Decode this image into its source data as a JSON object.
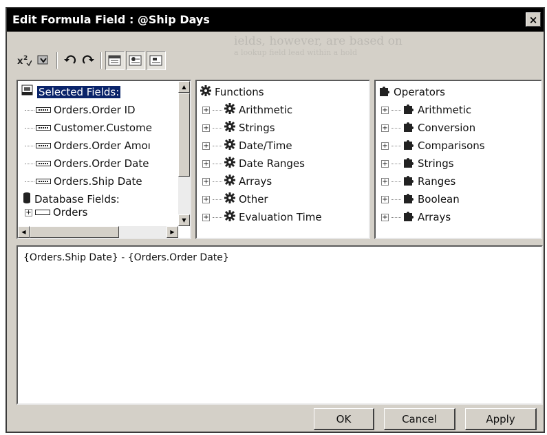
{
  "window": {
    "title": "Edit Formula Field : @Ship Days",
    "close_label": "×"
  },
  "background_text": {
    "line1": "ields, however, are based on  ",
    "line2": "a lookup field  lead within a hold"
  },
  "toolbar": {
    "icons": [
      "superscript-check-icon",
      "formula-expert-icon",
      "undo-icon",
      "redo-icon",
      "field-tree-icon",
      "function-tree-icon",
      "operator-tree-icon"
    ]
  },
  "fields_tree": {
    "selected_header": "Selected Fields:",
    "items": [
      "Orders.Order ID",
      "Customer.Custome",
      "Orders.Order Amoı",
      "Orders.Order Date",
      "Orders.Ship Date"
    ],
    "database_header": "Database Fields:",
    "partial_item": "Orders"
  },
  "functions_tree": {
    "header": "Functions",
    "items": [
      "Arithmetic",
      "Strings",
      "Date/Time",
      "Date Ranges",
      "Arrays",
      "Other",
      "Evaluation Time"
    ]
  },
  "operators_tree": {
    "header": "Operators",
    "items": [
      "Arithmetic",
      "Conversion",
      "Comparisons",
      "Strings",
      "Ranges",
      "Boolean",
      "Arrays"
    ]
  },
  "formula": {
    "text": "{Orders.Ship Date} - {Orders.Order Date}"
  },
  "buttons": {
    "ok": "OK",
    "cancel": "Cancel",
    "apply": "Apply"
  }
}
